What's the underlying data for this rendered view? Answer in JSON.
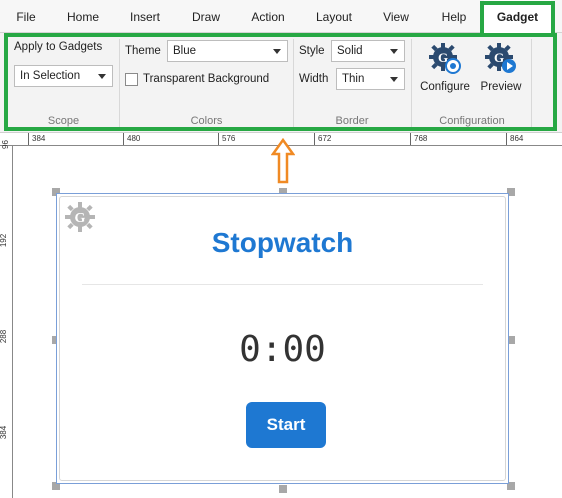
{
  "tabs": [
    {
      "label": "File"
    },
    {
      "label": "Home"
    },
    {
      "label": "Insert"
    },
    {
      "label": "Draw"
    },
    {
      "label": "Action"
    },
    {
      "label": "Layout"
    },
    {
      "label": "View"
    },
    {
      "label": "Help"
    },
    {
      "label": "Gadget"
    }
  ],
  "active_tab": "Gadget",
  "ribbon": {
    "scope": {
      "apply_label": "Apply to Gadgets",
      "apply_value": "In Selection",
      "group_label": "Scope"
    },
    "colors": {
      "theme_label": "Theme",
      "theme_value": "Blue",
      "transparent_label": "Transparent Background",
      "transparent_checked": false,
      "group_label": "Colors"
    },
    "border": {
      "style_label": "Style",
      "style_value": "Solid",
      "width_label": "Width",
      "width_value": "Thin",
      "group_label": "Border"
    },
    "configuration": {
      "configure_label": "Configure",
      "preview_label": "Preview",
      "group_label": "Configuration"
    }
  },
  "ruler": {
    "top_numbers": [
      "384",
      "480",
      "576",
      "672",
      "768",
      "864"
    ],
    "left_numbers": [
      "96",
      "192",
      "288",
      "384"
    ]
  },
  "gadget": {
    "title": "Stopwatch",
    "time": "0:00",
    "start_label": "Start"
  },
  "colors": {
    "highlight": "#27a844",
    "accent": "#1e78d2",
    "arrow": "#f08a24"
  }
}
